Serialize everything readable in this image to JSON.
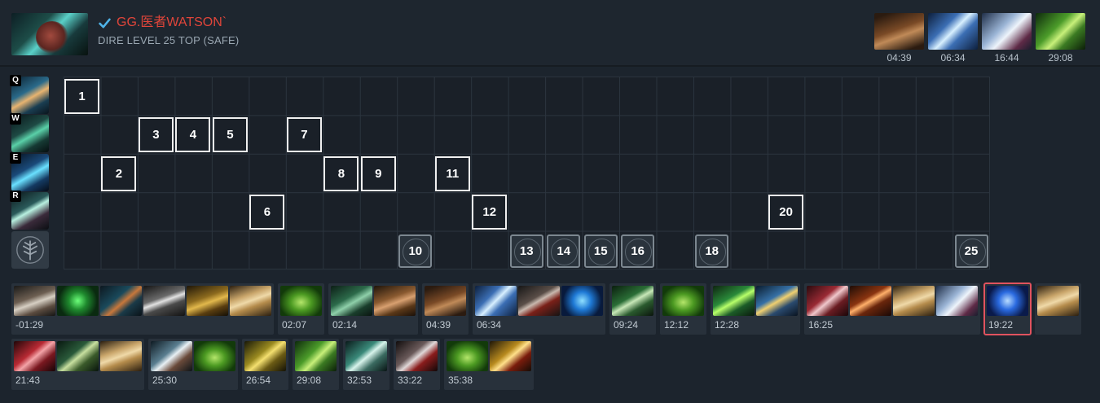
{
  "player": {
    "name": "GG.医者WATSON`",
    "subtitle": "DIRE LEVEL 25 TOP (SAFE)"
  },
  "core_items": [
    {
      "icon": "power-treads-icon",
      "color_class": "c-boots",
      "time": "04:39"
    },
    {
      "icon": "blink-blade-icon",
      "color_class": "c-blade",
      "time": "06:34"
    },
    {
      "icon": "battle-axe-icon",
      "color_class": "c-axe",
      "time": "16:44"
    },
    {
      "icon": "green-blade-icon",
      "color_class": "c-green",
      "time": "29:08"
    }
  ],
  "skills": [
    {
      "key": "Q",
      "icon": "skill-q-icon"
    },
    {
      "key": "W",
      "icon": "skill-w-icon"
    },
    {
      "key": "E",
      "icon": "skill-e-icon"
    },
    {
      "key": "R",
      "icon": "skill-r-icon"
    }
  ],
  "skill_build": [
    {
      "level": "1",
      "row": 0,
      "col": 0
    },
    {
      "level": "2",
      "row": 2,
      "col": 1
    },
    {
      "level": "3",
      "row": 1,
      "col": 2
    },
    {
      "level": "4",
      "row": 1,
      "col": 3
    },
    {
      "level": "5",
      "row": 1,
      "col": 4
    },
    {
      "level": "6",
      "row": 3,
      "col": 5
    },
    {
      "level": "7",
      "row": 1,
      "col": 6
    },
    {
      "level": "8",
      "row": 2,
      "col": 7
    },
    {
      "level": "9",
      "row": 2,
      "col": 8
    },
    {
      "level": "10",
      "row": 4,
      "col": 9
    },
    {
      "level": "11",
      "row": 2,
      "col": 10
    },
    {
      "level": "12",
      "row": 3,
      "col": 11
    },
    {
      "level": "13",
      "row": 4,
      "col": 12
    },
    {
      "level": "14",
      "row": 4,
      "col": 13
    },
    {
      "level": "15",
      "row": 4,
      "col": 14
    },
    {
      "level": "16",
      "row": 4,
      "col": 15
    },
    {
      "level": "18",
      "row": 4,
      "col": 17
    },
    {
      "level": "20",
      "row": 3,
      "col": 19
    },
    {
      "level": "25",
      "row": 4,
      "col": 24
    }
  ],
  "item_groups": [
    {
      "time": "-01:29",
      "items": [
        {
          "icon": "tango-icon",
          "c": "c-tango"
        },
        {
          "icon": "slippers-icon",
          "c": "c-slipper"
        },
        {
          "icon": "branch-icon",
          "c": "c-branch"
        },
        {
          "icon": "circlet-icon",
          "c": "c-circlet"
        },
        {
          "icon": "gauntlets-icon",
          "c": "c-gauntlet"
        },
        {
          "icon": "recipe-scroll-icon",
          "c": "c-scroll"
        }
      ]
    },
    {
      "time": "02:07",
      "items": [
        {
          "icon": "wraith-band-icon",
          "c": "c-leaf"
        }
      ]
    },
    {
      "time": "02:14",
      "items": [
        {
          "icon": "hammer-icon",
          "c": "c-hammer"
        },
        {
          "icon": "boots-icon",
          "c": "c-boots2"
        }
      ]
    },
    {
      "time": "04:39",
      "items": [
        {
          "icon": "power-treads-icon",
          "c": "c-boots"
        }
      ]
    },
    {
      "time": "06:34",
      "items": [
        {
          "icon": "blink-blade-icon",
          "c": "c-blade"
        },
        {
          "icon": "vanguard-icon",
          "c": "c-vanguard"
        },
        {
          "icon": "blue-orb-icon",
          "c": "c-orb"
        }
      ]
    },
    {
      "time": "09:24",
      "items": [
        {
          "icon": "kris-icon",
          "c": "c-kris"
        }
      ]
    },
    {
      "time": "12:12",
      "items": [
        {
          "icon": "wraith-band-icon",
          "c": "c-leaf"
        }
      ]
    },
    {
      "time": "12:28",
      "items": [
        {
          "icon": "diffusal-icon",
          "c": "c-ds"
        },
        {
          "icon": "aquila-icon",
          "c": "c-aquila"
        }
      ]
    },
    {
      "time": "16:25",
      "items": [
        {
          "icon": "sabre-icon",
          "c": "c-sabre"
        },
        {
          "icon": "mjollnir-icon",
          "c": "c-mjollnir"
        },
        {
          "icon": "recipe-scroll-icon",
          "c": "c-scroll"
        },
        {
          "icon": "battle-axe-icon",
          "c": "c-axe"
        }
      ]
    },
    {
      "time": "19:22",
      "items": [
        {
          "icon": "aghanims-shard-icon",
          "c": "c-shard"
        }
      ],
      "highlight": true
    },
    {
      "time": "",
      "items": [
        {
          "icon": "recipe-scroll-icon",
          "c": "c-scroll"
        }
      ]
    },
    {
      "time": "21:43",
      "items": [
        {
          "icon": "butterfly-icon",
          "c": "c-butterfly"
        },
        {
          "icon": "staff-icon",
          "c": "c-staff"
        },
        {
          "icon": "recipe-scroll-icon",
          "c": "c-scroll"
        }
      ]
    },
    {
      "time": "25:30",
      "items": [
        {
          "icon": "dagon-icon",
          "c": "c-dagon"
        },
        {
          "icon": "leaf-icon",
          "c": "c-leaf"
        }
      ]
    },
    {
      "time": "26:54",
      "items": [
        {
          "icon": "moon-shard-icon",
          "c": "c-moonshard"
        }
      ]
    },
    {
      "time": "29:08",
      "items": [
        {
          "icon": "green-blade-icon",
          "c": "c-green"
        }
      ]
    },
    {
      "time": "32:53",
      "items": [
        {
          "icon": "skadi-icon",
          "c": "c-skadi"
        }
      ]
    },
    {
      "time": "33:22",
      "items": [
        {
          "icon": "abyssal-icon",
          "c": "c-abyssal"
        }
      ]
    },
    {
      "time": "35:38",
      "items": [
        {
          "icon": "leaf-icon",
          "c": "c-leaf"
        },
        {
          "icon": "bloodstone-icon",
          "c": "c-bloodstone"
        }
      ]
    }
  ],
  "colors": {
    "accent_name": "#e0453a",
    "verified": "#4fb3e8",
    "highlight": "#e0535f"
  }
}
